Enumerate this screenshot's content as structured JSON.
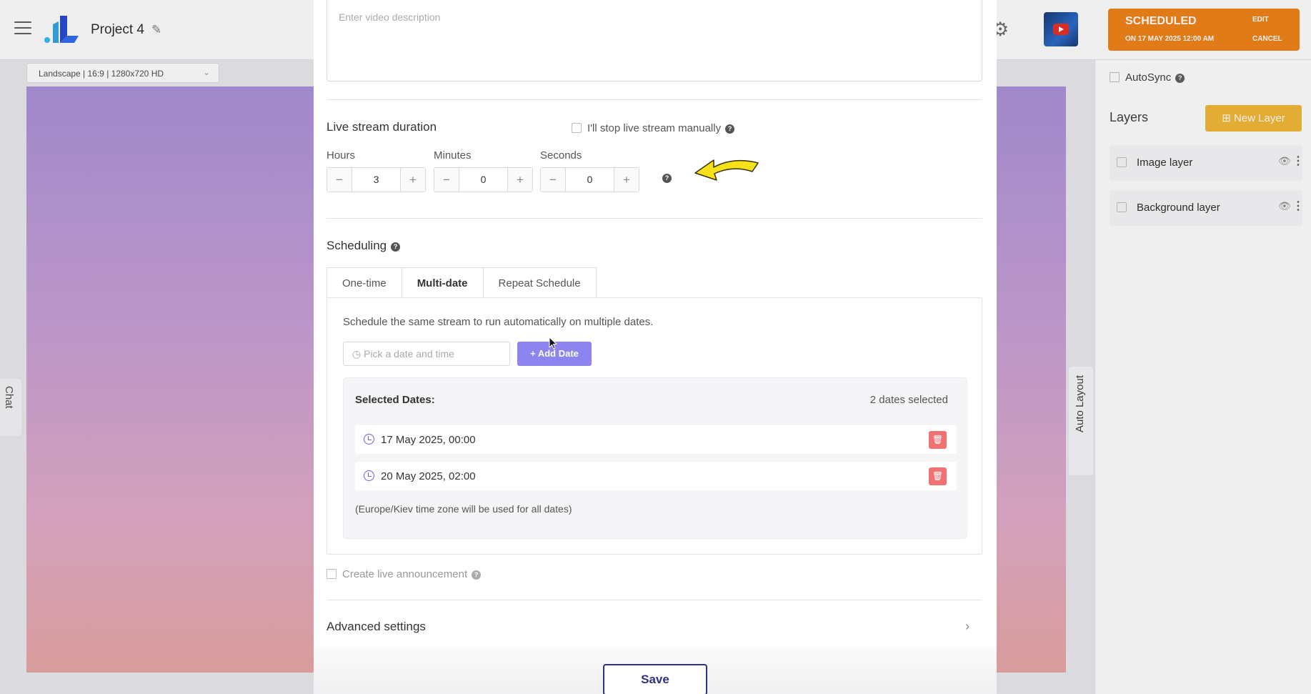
{
  "app": {
    "project_title": "Project 4",
    "format": "Landscape | 16:9 | 1280x720 HD",
    "chat_label": "Chat",
    "auto_layout_label": "Auto Layout",
    "status": {
      "state": "SCHEDULED",
      "when": "ON 17 MAY 2025 12:00 AM",
      "edit": "EDIT",
      "cancel": "CANCEL",
      "color": "#f07c0a"
    }
  },
  "right_panel": {
    "autosync_label": "AutoSync",
    "layers_title": "Layers",
    "new_layer_label": "New Layer",
    "layers": [
      {
        "name": "Image layer"
      },
      {
        "name": "Background layer"
      }
    ]
  },
  "modal": {
    "description_placeholder": "Enter video description",
    "duration": {
      "title": "Live stream duration",
      "manual_label": "I'll stop live stream manually",
      "hours_label": "Hours",
      "minutes_label": "Minutes",
      "seconds_label": "Seconds",
      "hours": "3",
      "minutes": "0",
      "seconds": "0"
    },
    "scheduling": {
      "title": "Scheduling",
      "tabs": [
        "One-time",
        "Multi-date",
        "Repeat Schedule"
      ],
      "active_tab": "Multi-date",
      "description": "Schedule the same stream to run automatically on multiple dates.",
      "date_placeholder": "Pick a date and time",
      "add_date_label": "Add Date",
      "selected_title": "Selected Dates:",
      "selected_count": "2 dates selected",
      "dates": [
        "17 May 2025, 00:00",
        "20 May 2025, 02:00"
      ],
      "timezone_note": "(Europe/Kiev time zone will be used for all dates)"
    },
    "announcement_label": "Create live announcement",
    "advanced_label": "Advanced settings",
    "save_label": "Save"
  },
  "colors": {
    "accent_purple": "#8d84f0",
    "save_border": "#2f3185",
    "delete_red": "#f07272",
    "new_layer_yellow": "#f2b42b"
  }
}
